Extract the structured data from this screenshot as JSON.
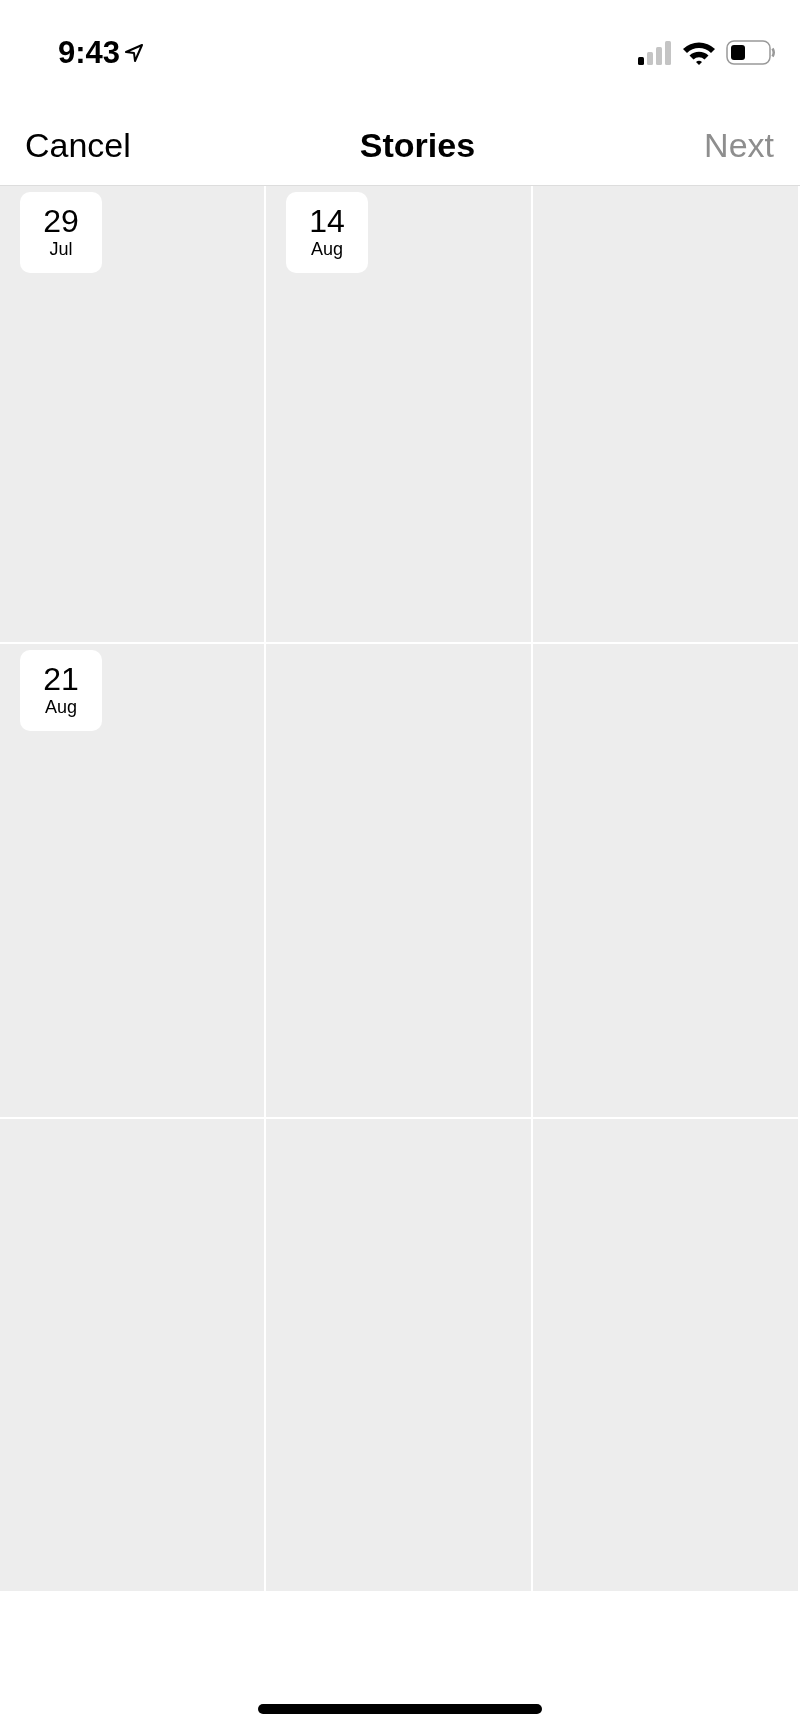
{
  "status_bar": {
    "time": "9:43"
  },
  "nav": {
    "cancel": "Cancel",
    "title": "Stories",
    "next": {
      "label": "Next",
      "disabled": true
    }
  },
  "tiles": [
    {
      "kind": "dated",
      "date": {
        "day": "29",
        "month": "Jul"
      }
    },
    {
      "kind": "dated",
      "date": {
        "day": "14",
        "month": "Aug"
      }
    },
    {
      "kind": "blank"
    },
    {
      "kind": "dated",
      "date": {
        "day": "21",
        "month": "Aug"
      }
    },
    {
      "kind": "blank"
    },
    {
      "kind": "blank"
    },
    {
      "kind": "blank"
    },
    {
      "kind": "blank"
    },
    {
      "kind": "blank"
    }
  ]
}
